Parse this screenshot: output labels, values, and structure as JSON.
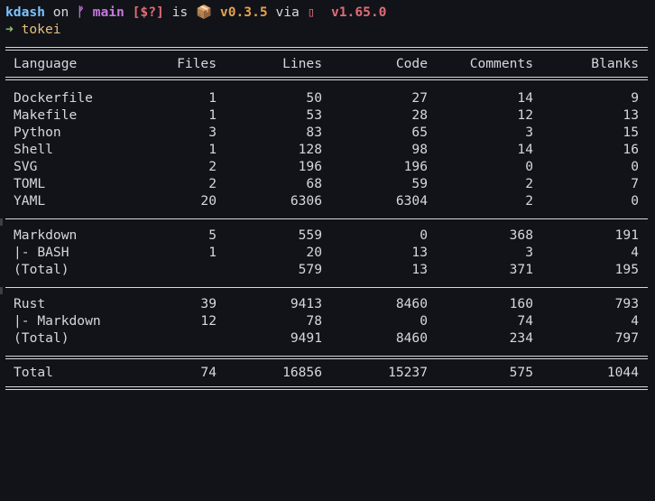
{
  "prompt": {
    "dir": "kdash",
    "on": "on",
    "git_icon": "ᚠ",
    "branch": "main",
    "status": "[$?]",
    "is": "is",
    "package_icon": "📦",
    "package_version": "v0.3.5",
    "via": "via",
    "rust_icon": "▯",
    "rust_version": "v1.65.0"
  },
  "command": {
    "arrow": "➜",
    "text": "tokei"
  },
  "table": {
    "headers": [
      "Language",
      "Files",
      "Lines",
      "Code",
      "Comments",
      "Blanks"
    ],
    "group1": [
      [
        "Dockerfile",
        "1",
        "50",
        "27",
        "14",
        "9"
      ],
      [
        "Makefile",
        "1",
        "53",
        "28",
        "12",
        "13"
      ],
      [
        "Python",
        "3",
        "83",
        "65",
        "3",
        "15"
      ],
      [
        "Shell",
        "1",
        "128",
        "98",
        "14",
        "16"
      ],
      [
        "SVG",
        "2",
        "196",
        "196",
        "0",
        "0"
      ],
      [
        "TOML",
        "2",
        "68",
        "59",
        "2",
        "7"
      ],
      [
        "YAML",
        "20",
        "6306",
        "6304",
        "2",
        "0"
      ]
    ],
    "group2": [
      [
        "Markdown",
        "5",
        "559",
        "0",
        "368",
        "191"
      ],
      [
        "|- BASH",
        "1",
        "20",
        "13",
        "3",
        "4"
      ],
      [
        "(Total)",
        "",
        "579",
        "13",
        "371",
        "195"
      ]
    ],
    "group3": [
      [
        "Rust",
        "39",
        "9413",
        "8460",
        "160",
        "793"
      ],
      [
        "|- Markdown",
        "12",
        "78",
        "0",
        "74",
        "4"
      ],
      [
        "(Total)",
        "",
        "9491",
        "8460",
        "234",
        "797"
      ]
    ],
    "total": [
      "Total",
      "74",
      "16856",
      "15237",
      "575",
      "1044"
    ]
  }
}
